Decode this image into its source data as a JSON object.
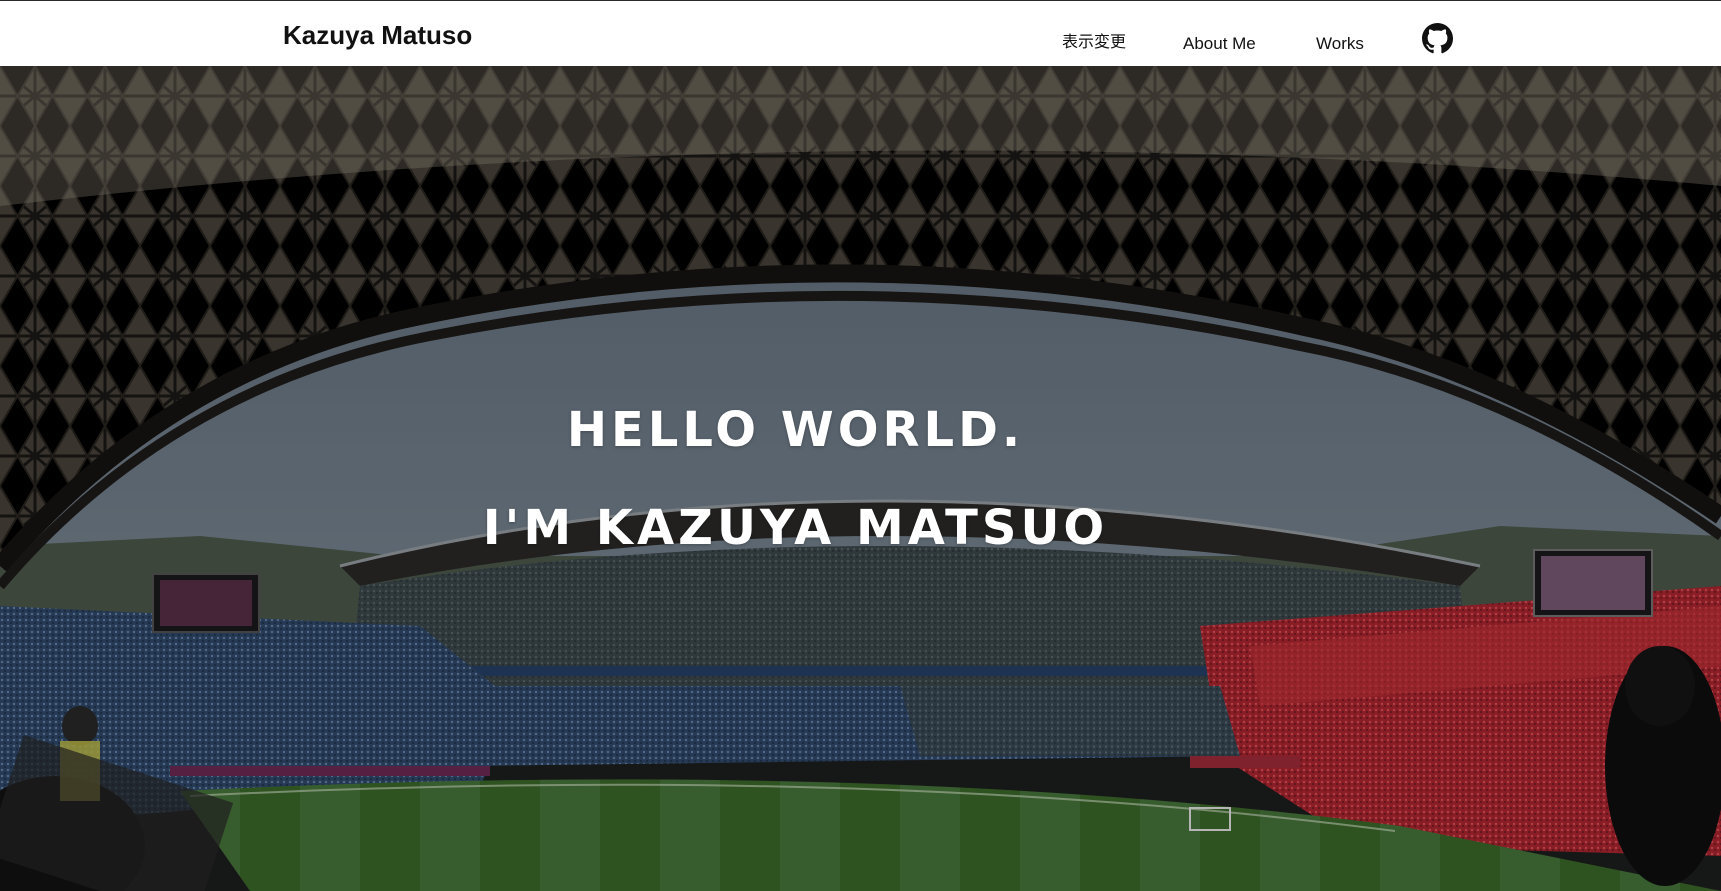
{
  "header": {
    "brand": "Kazuya Matuso",
    "nav": {
      "display_toggle": "表示変更",
      "about": "About Me",
      "works": "Works"
    },
    "github_icon": "github-icon"
  },
  "hero": {
    "line1": "HELLO WORLD.",
    "line2": "I'M KAZUYA MATSUO",
    "background": "stadium-panorama-image"
  },
  "colors": {
    "header_bg": "#ffffff",
    "header_text": "#111111",
    "hero_text": "#ffffff",
    "sky": "#6f7c8a",
    "pitch": "#3f6a2c",
    "home_stand": "#b8232b",
    "away_stand": "#2f4f78"
  }
}
